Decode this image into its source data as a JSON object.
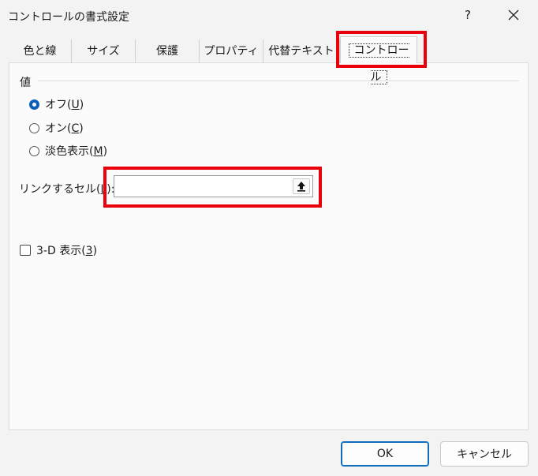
{
  "window": {
    "title": "コントロールの書式設定",
    "help": "?"
  },
  "tabs": [
    {
      "label": "色と線"
    },
    {
      "label": "サイズ"
    },
    {
      "label": "保護"
    },
    {
      "label": "プロパティ"
    },
    {
      "label": "代替テキスト"
    },
    {
      "label": "コントロール",
      "active": true
    }
  ],
  "value_group": {
    "title": "値",
    "options": [
      {
        "label": "オフ(",
        "accel": "U",
        "suffix": ")",
        "checked": true
      },
      {
        "label": "オン(",
        "accel": "C",
        "suffix": ")",
        "checked": false
      },
      {
        "label": "淡色表示(",
        "accel": "M",
        "suffix": ")",
        "checked": false
      }
    ]
  },
  "link_cell": {
    "label": "リンクするセル(",
    "accel": "L",
    "suffix": "):",
    "value": ""
  },
  "three_d": {
    "label": "3-D 表示(",
    "accel": "3",
    "suffix": ")",
    "checked": false
  },
  "buttons": {
    "ok": "OK",
    "cancel": "キャンセル"
  },
  "colors": {
    "highlight": "#e8000b",
    "accent": "#0f6cbd"
  },
  "icons": {
    "close": "close-icon",
    "ref_button": "collapse-dialog-arrow-icon"
  }
}
